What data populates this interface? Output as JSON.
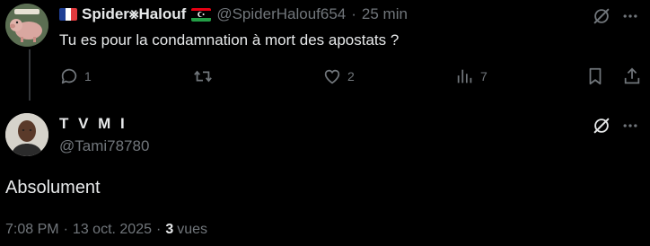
{
  "parent": {
    "display_name": "Spider⨳Halouf",
    "handle": "@SpiderHalouf654",
    "separator": "·",
    "time": "25 min",
    "text": "Tu es pour la condamnation à mort des apostats ?",
    "flags": [
      "flag-france-icon",
      "flag-libya-icon"
    ],
    "actions": {
      "replies": "1",
      "reposts": "",
      "likes": "2",
      "views": "7"
    }
  },
  "main": {
    "display_name": "T V M I",
    "handle": "@Tami78780",
    "text": "Absolument",
    "time": "7:08 PM",
    "date": "13 oct. 2025",
    "views_count": "3",
    "views_label": "vues",
    "dot": "·"
  },
  "colors": {
    "background": "#000000",
    "primary_text": "#e7e9ea",
    "secondary_text": "#71767b",
    "thread_line": "#333639"
  }
}
